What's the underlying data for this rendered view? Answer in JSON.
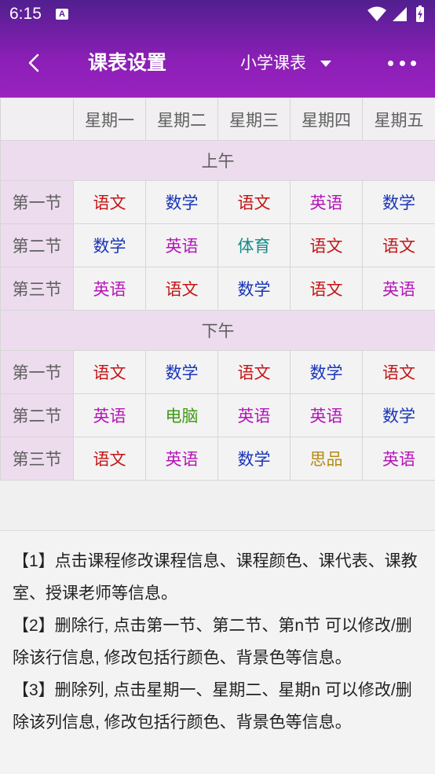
{
  "status": {
    "time": "6:15",
    "notif": "A"
  },
  "toolbar": {
    "title": "课表设置",
    "dropdown_label": "小学课表"
  },
  "table": {
    "days": [
      "星期一",
      "星期二",
      "星期三",
      "星期四",
      "星期五"
    ],
    "sections": [
      {
        "name": "上午",
        "rows": [
          {
            "label": "第一节",
            "cells": [
              {
                "text": "语文",
                "color": "#c41414"
              },
              {
                "text": "数学",
                "color": "#1a35b8"
              },
              {
                "text": "语文",
                "color": "#c41414"
              },
              {
                "text": "英语",
                "color": "#b514b8"
              },
              {
                "text": "数学",
                "color": "#1a35b8"
              }
            ]
          },
          {
            "label": "第二节",
            "cells": [
              {
                "text": "数学",
                "color": "#1a35b8"
              },
              {
                "text": "英语",
                "color": "#b514b8"
              },
              {
                "text": "体育",
                "color": "#138a8a"
              },
              {
                "text": "语文",
                "color": "#c41414"
              },
              {
                "text": "语文",
                "color": "#c41414"
              }
            ]
          },
          {
            "label": "第三节",
            "cells": [
              {
                "text": "英语",
                "color": "#b514b8"
              },
              {
                "text": "语文",
                "color": "#c41414"
              },
              {
                "text": "数学",
                "color": "#1a35b8"
              },
              {
                "text": "语文",
                "color": "#c41414"
              },
              {
                "text": "英语",
                "color": "#b514b8"
              }
            ]
          }
        ]
      },
      {
        "name": "下午",
        "rows": [
          {
            "label": "第一节",
            "cells": [
              {
                "text": "语文",
                "color": "#c41414"
              },
              {
                "text": "数学",
                "color": "#1a35b8"
              },
              {
                "text": "语文",
                "color": "#c41414"
              },
              {
                "text": "数学",
                "color": "#1a35b8"
              },
              {
                "text": "语文",
                "color": "#c41414"
              }
            ]
          },
          {
            "label": "第二节",
            "cells": [
              {
                "text": "英语",
                "color": "#b514b8"
              },
              {
                "text": "电脑",
                "color": "#3f9a14"
              },
              {
                "text": "英语",
                "color": "#b514b8"
              },
              {
                "text": "英语",
                "color": "#b514b8"
              },
              {
                "text": "数学",
                "color": "#1a35b8"
              }
            ]
          },
          {
            "label": "第三节",
            "cells": [
              {
                "text": "语文",
                "color": "#c41414"
              },
              {
                "text": "英语",
                "color": "#b514b8"
              },
              {
                "text": "数学",
                "color": "#1a35b8"
              },
              {
                "text": "思品",
                "color": "#b58a14"
              },
              {
                "text": "英语",
                "color": "#b514b8"
              }
            ]
          }
        ]
      }
    ]
  },
  "notes": [
    "【1】点击课程修改课程信息、课程颜色、课代表、课教室、授课老师等信息。",
    "【2】删除行, 点击第一节、第二节、第n节 可以修改/删除该行信息, 修改包括行颜色、背景色等信息。",
    "【3】删除列, 点击星期一、星期二、星期n 可以修改/删除该列信息, 修改包括行颜色、背景色等信息。"
  ]
}
